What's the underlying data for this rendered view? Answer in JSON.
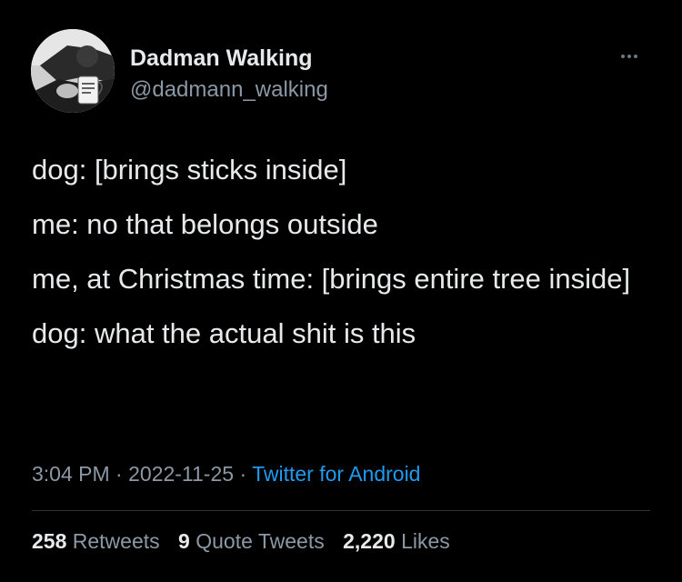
{
  "user": {
    "display_name": "Dadman Walking",
    "handle": "@dadmann_walking",
    "avatar_icon": "profile-photo-person-with-mug"
  },
  "tweet": {
    "lines": [
      "dog: [brings sticks inside]",
      "me: no that belongs outside",
      "me, at Christmas time: [brings entire tree inside]",
      "dog: what the actual shit is this"
    ],
    "time": "3:04 PM",
    "separator": "·",
    "date": "2022-11-25",
    "source": "Twitter for Android"
  },
  "stats": {
    "retweets_count": "258",
    "retweets_label": "Retweets",
    "quotes_count": "9",
    "quotes_label": "Quote Tweets",
    "likes_count": "2,220",
    "likes_label": "Likes"
  },
  "colors": {
    "background": "#000000",
    "text": "#e7e9ea",
    "secondary": "#8b98a5",
    "link": "#1d9bf0"
  },
  "icons": {
    "more": "more-dots-icon"
  }
}
